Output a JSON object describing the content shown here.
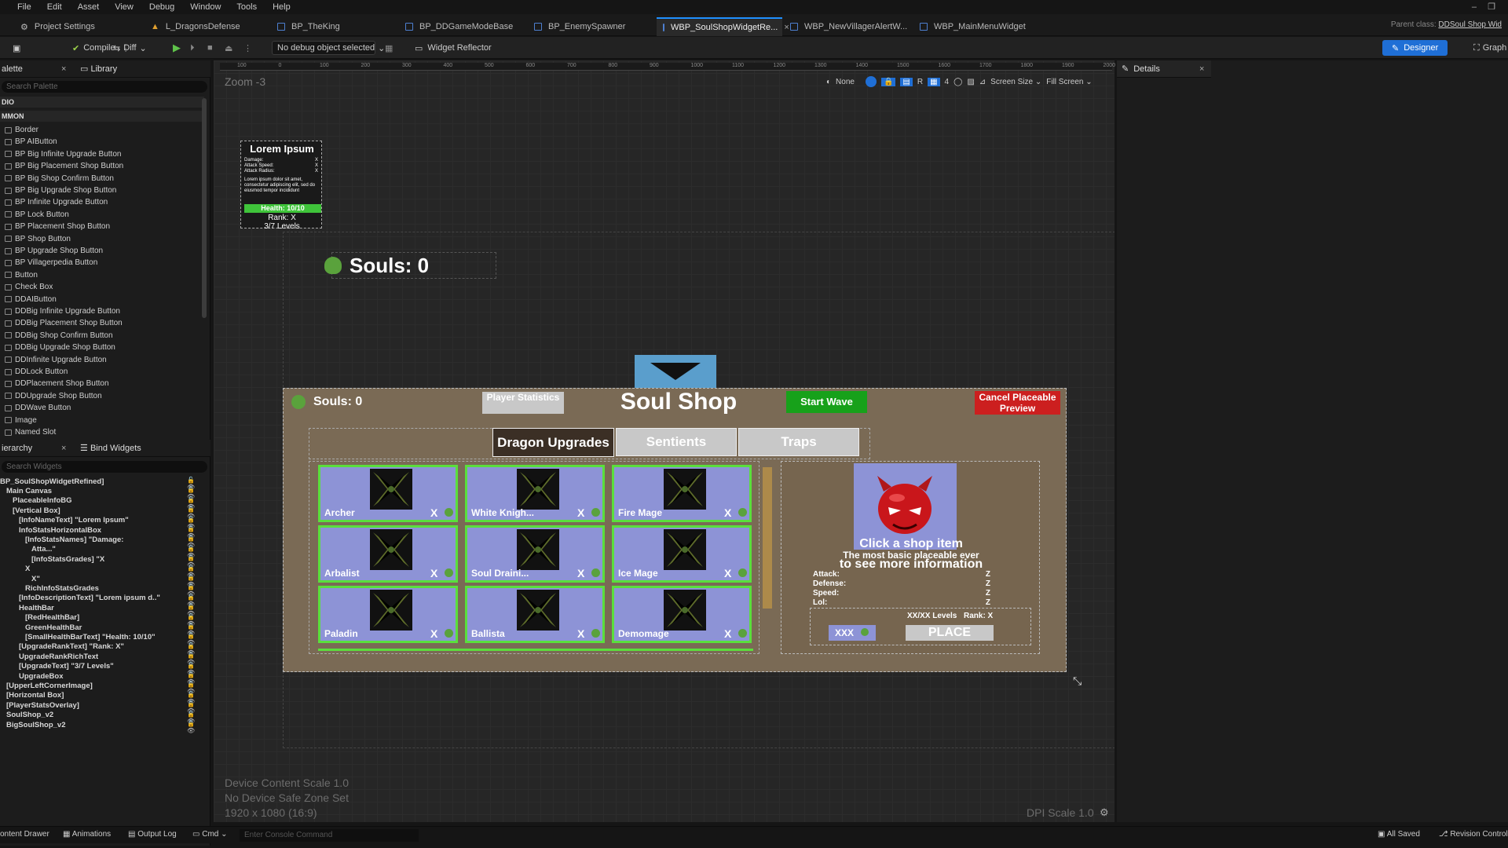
{
  "menu": [
    "File",
    "Edit",
    "Asset",
    "View",
    "Debug",
    "Window",
    "Tools",
    "Help"
  ],
  "tabs": [
    {
      "label": "Project Settings"
    },
    {
      "label": "L_DragonsDefense"
    },
    {
      "label": "BP_TheKing"
    },
    {
      "label": "BP_DDGameModeBase"
    },
    {
      "label": "BP_EnemySpawner"
    },
    {
      "label": "WBP_SoulShopWidgetRe..."
    },
    {
      "label": "WBP_NewVillagerAlertW..."
    },
    {
      "label": "WBP_MainMenuWidget"
    }
  ],
  "parent_class_label": "Parent class:",
  "parent_class_value": "DDSoul Shop Wid",
  "toolbar": {
    "compile": "Compile",
    "diff": "Diff",
    "debug_object": "No debug object selected",
    "widget_reflector": "Widget Reflector",
    "designer": "Designer",
    "graph": "Graph"
  },
  "palette": {
    "tab": "alette",
    "library_tab": "Library",
    "search_placeholder": "Search Palette",
    "section1": "DIO",
    "section2": "MMON",
    "items": [
      "Border",
      "BP AIButton",
      "BP Big Infinite Upgrade Button",
      "BP Big Placement Shop Button",
      "BP Big Shop Confirm Button",
      "BP Big Upgrade Shop Button",
      "BP Infinite Upgrade Button",
      "BP Lock Button",
      "BP Placement Shop Button",
      "BP Shop Button",
      "BP Upgrade Shop Button",
      "BP Villagerpedia Button",
      "Button",
      "Check Box",
      "DDAIButton",
      "DDBig Infinite Upgrade Button",
      "DDBig Placement Shop Button",
      "DDBig Shop Confirm Button",
      "DDBig Upgrade Shop Button",
      "DDInfinite Upgrade Button",
      "DDLock Button",
      "DDPlacement Shop Button",
      "DDUpgrade Shop Button",
      "DDWave Button",
      "Image",
      "Named Slot"
    ]
  },
  "hierarchy": {
    "tab": "ierarchy",
    "bind_tab": "Bind Widgets",
    "search_placeholder": "Search Widgets",
    "items": [
      {
        "label": "BP_SoulShopWidgetRefined]",
        "indent": 0
      },
      {
        "label": "Main Canvas",
        "indent": 1
      },
      {
        "label": "PlaceableInfoBG",
        "indent": 2
      },
      {
        "label": "[Vertical Box]",
        "indent": 2
      },
      {
        "label": "[InfoNameText] \"Lorem Ipsum\"",
        "indent": 3
      },
      {
        "label": "InfoStatsHorizontalBox",
        "indent": 3
      },
      {
        "label": "[InfoStatsNames] \"Damage:",
        "indent": 4
      },
      {
        "label": "Atta...\"",
        "indent": 5
      },
      {
        "label": "[InfoStatsGrades] \"X",
        "indent": 5
      },
      {
        "label": "X",
        "indent": 4
      },
      {
        "label": "X\"",
        "indent": 5
      },
      {
        "label": "RichInfoStatsGrades",
        "indent": 4
      },
      {
        "label": "[InfoDescriptionText] \"Lorem ipsum d..\"",
        "indent": 3
      },
      {
        "label": "HealthBar",
        "indent": 3
      },
      {
        "label": "[RedHealthBar]",
        "indent": 4
      },
      {
        "label": "GreenHealthBar",
        "indent": 4
      },
      {
        "label": "[SmallHealthBarText] \"Health: 10/10\"",
        "indent": 4
      },
      {
        "label": "[UpgradeRankText] \"Rank: X\"",
        "indent": 3
      },
      {
        "label": "UpgradeRankRichText",
        "indent": 3
      },
      {
        "label": "[UpgradeText] \"3/7 Levels\"",
        "indent": 3
      },
      {
        "label": "UpgradeBox",
        "indent": 3
      },
      {
        "label": "[UpperLeftCornerImage]",
        "indent": 1
      },
      {
        "label": "[Horizontal Box]",
        "indent": 1
      },
      {
        "label": "[PlayerStatsOverlay]",
        "indent": 1
      },
      {
        "label": "SoulShop_v2",
        "indent": 1
      },
      {
        "label": "BigSoulShop_v2",
        "indent": 1
      }
    ]
  },
  "viewport": {
    "zoom": "Zoom -3",
    "none_label": "None",
    "r_label": "R",
    "grid_num": "4",
    "screen_size": "Screen Size",
    "fill_screen": "Fill Screen",
    "ruler_ticks": [
      "100",
      "0",
      "100",
      "200",
      "300",
      "400",
      "500",
      "600",
      "700",
      "800",
      "900",
      "1000",
      "1100",
      "1200",
      "1300",
      "1400",
      "1500",
      "1600",
      "1700",
      "1800",
      "1900",
      "2000"
    ],
    "device_scale": "Device Content Scale 1.0",
    "safe_zone": "No Device Safe Zone Set",
    "resolution": "1920 x 1080 (16:9)",
    "dpi": "DPI Scale 1.0"
  },
  "details": {
    "title": "Details"
  },
  "info_card": {
    "name": "Lorem Ipsum",
    "stats": [
      "Damage:",
      "Attack Speed:",
      "Attack Radius:"
    ],
    "grades": [
      "X",
      "X",
      "X"
    ],
    "description": "Lorem ipsum dolor sit amet, consectetur adipiscing elit, sed do eiusmod tempor incididunt",
    "health": "Health: 10/10",
    "rank": "Rank: X",
    "levels": "3/7 Levels"
  },
  "top_souls": "Souls: 0",
  "shop": {
    "souls": "Souls: 0",
    "player_stats": "Player Statistics",
    "title": "Soul Shop",
    "start_wave": "Start Wave",
    "cancel": "Cancel Placeable Preview",
    "tabs": [
      "Dragon Upgrades",
      "Sentients",
      "Traps"
    ],
    "items": [
      {
        "name": "Archer",
        "price": "X"
      },
      {
        "name": "White Knigh...",
        "price": "X"
      },
      {
        "name": "Fire Mage",
        "price": "X"
      },
      {
        "name": "Arbalist",
        "price": "X"
      },
      {
        "name": "Soul Draini...",
        "price": "X"
      },
      {
        "name": "Ice Mage",
        "price": "X"
      },
      {
        "name": "Paladin",
        "price": "X"
      },
      {
        "name": "Ballista",
        "price": "X"
      },
      {
        "name": "Demomage",
        "price": "X"
      }
    ],
    "detail": {
      "headline1": "Click a shop item",
      "headline2": "to see more information",
      "subtitle": "The most basic placeable ever",
      "stats": [
        {
          "k": "Attack:",
          "v": "Z"
        },
        {
          "k": "Defense:",
          "v": "Z"
        },
        {
          "k": "Speed:",
          "v": "Z"
        },
        {
          "k": "Lol:",
          "v": "Z"
        }
      ],
      "levels": "XX/XX Levels",
      "rank": "Rank: X",
      "price": "XXX",
      "place": "PLACE"
    }
  },
  "statusbar": {
    "content_drawer": "ontent Drawer",
    "animations": "Animations",
    "output_log": "Output Log",
    "cmd": "Cmd",
    "console_placeholder": "Enter Console Command",
    "all_saved": "All Saved",
    "revision": "Revision Control"
  },
  "colors": {
    "accent": "#1f6fd6",
    "shop_bg": "#7a6a55",
    "cell_bg": "#8d93d6",
    "cell_border": "#5adf3c",
    "start_wave": "#17a11a",
    "cancel": "#cc1f1f",
    "tab_active": "#3b2f25",
    "tab_inactive": "#c8c8c8"
  }
}
